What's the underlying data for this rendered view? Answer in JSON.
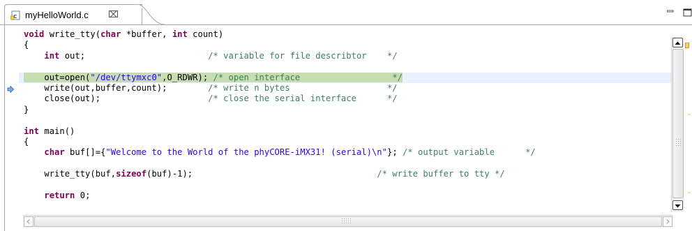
{
  "tab": {
    "title": "myHelloWorld.c",
    "close_glyph": "⌧",
    "icon": "c-source-file-icon"
  },
  "window": {
    "minimize_icon": "minimize-icon",
    "maximize_icon": "maximize-icon"
  },
  "code_lines": [
    {
      "segments": [
        {
          "t": "void",
          "c": "kw"
        },
        {
          "t": " write_tty("
        },
        {
          "t": "char",
          "c": "kw"
        },
        {
          "t": " *buffer, "
        },
        {
          "t": "int",
          "c": "kw"
        },
        {
          "t": " count)"
        }
      ]
    },
    {
      "segments": [
        {
          "t": "{"
        }
      ]
    },
    {
      "segments": [
        {
          "t": "    "
        },
        {
          "t": "int",
          "c": "kw"
        },
        {
          "t": " out;                        "
        },
        {
          "t": "/* variable for file describtor    */",
          "c": "cm"
        }
      ]
    },
    {
      "segments": [
        {
          "t": ""
        }
      ]
    },
    {
      "highlight": true,
      "segments": [
        {
          "t": "    ",
          "c": "sel"
        },
        {
          "t": "out=open(",
          "c": "sel"
        },
        {
          "t": "\"/dev/ttymxc0\"",
          "c": "str sel"
        },
        {
          "t": ",O_RDWR); ",
          "c": "sel"
        },
        {
          "t": "/* open interface                  */",
          "c": "cm sel"
        }
      ]
    },
    {
      "segments": [
        {
          "t": "    write(out,buffer,count);        "
        },
        {
          "t": "/* write n bytes                   */",
          "c": "cm"
        }
      ]
    },
    {
      "segments": [
        {
          "t": "    close(out);                     "
        },
        {
          "t": "/* close the serial interface      */",
          "c": "cm"
        }
      ]
    },
    {
      "segments": [
        {
          "t": "}"
        }
      ]
    },
    {
      "segments": [
        {
          "t": ""
        }
      ]
    },
    {
      "segments": [
        {
          "t": "int",
          "c": "kw"
        },
        {
          "t": " main()"
        }
      ]
    },
    {
      "segments": [
        {
          "t": "{"
        }
      ]
    },
    {
      "segments": [
        {
          "t": "    "
        },
        {
          "t": "char",
          "c": "kw"
        },
        {
          "t": " buf[]={"
        },
        {
          "t": "\"Welcome to the World of the phyCORE-iMX31! (serial)\\n\"",
          "c": "str"
        },
        {
          "t": "}; "
        },
        {
          "t": "/* output variable      */",
          "c": "cm"
        }
      ]
    },
    {
      "segments": [
        {
          "t": ""
        }
      ]
    },
    {
      "segments": [
        {
          "t": "    write_tty(buf,"
        },
        {
          "t": "sizeof",
          "c": "kw"
        },
        {
          "t": "(buf)-1);                                    "
        },
        {
          "t": "/* write buffer to tty */",
          "c": "cm"
        }
      ]
    },
    {
      "segments": [
        {
          "t": ""
        }
      ]
    },
    {
      "segments": [
        {
          "t": "    "
        },
        {
          "t": "return",
          "c": "kw"
        },
        {
          "t": " 0;"
        }
      ]
    }
  ],
  "colors": {
    "keyword": "#7f0055",
    "string": "#2a00ff",
    "comment": "#3f7f5f",
    "current_line": "#e8f2fe",
    "selection": "#c6dcb1"
  },
  "icons": {
    "instruction_pointer": "instruction-pointer-arrow-icon",
    "scroll_up": "scroll-up-arrow-icon",
    "scroll_down": "scroll-down-arrow-icon",
    "scroll_left": "scroll-left-arrow-icon",
    "scroll_right": "scroll-right-arrow-icon"
  }
}
